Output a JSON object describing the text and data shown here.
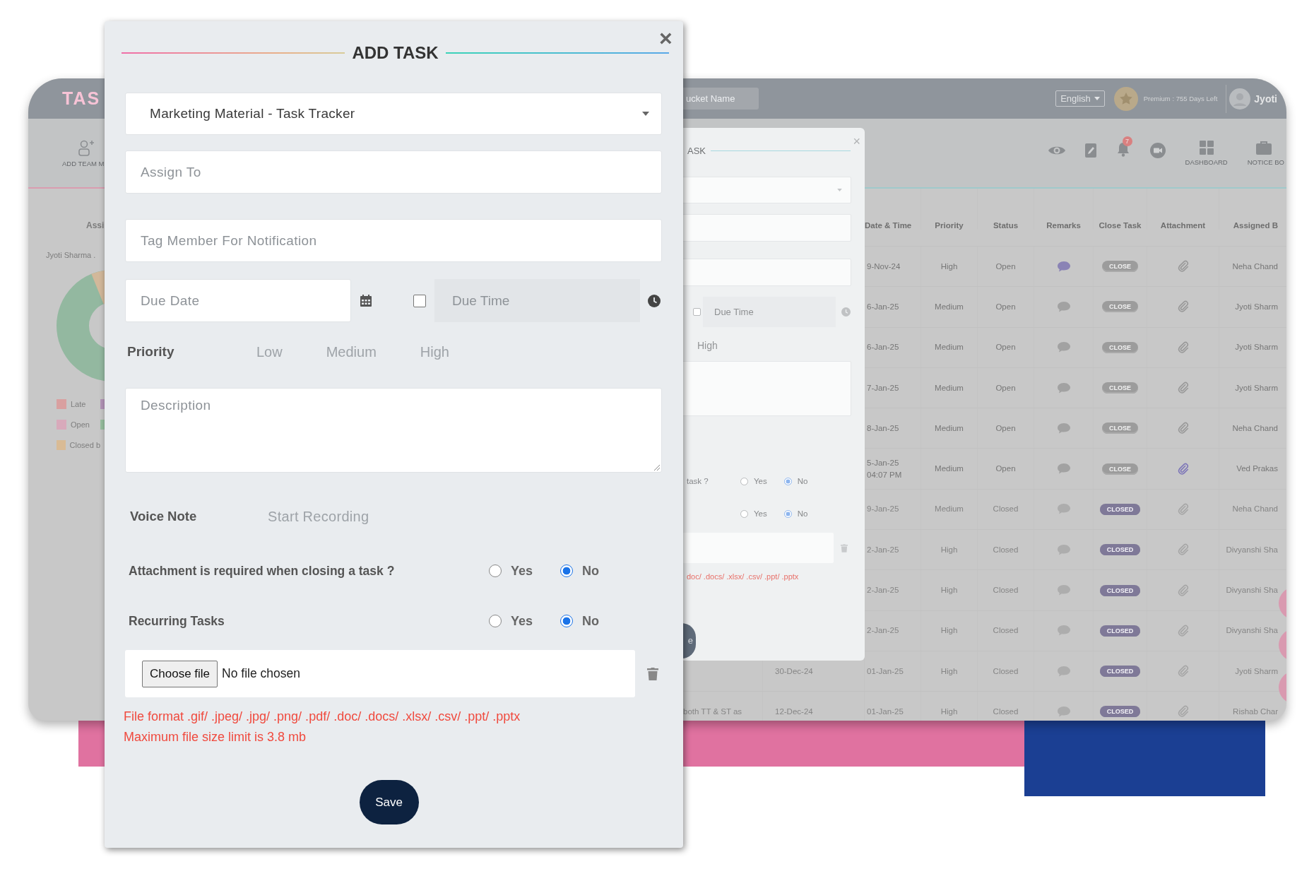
{
  "background_app": {
    "logo": "TAS",
    "bucket_field": {
      "placeholder": "ucket Name"
    },
    "language": "English",
    "premium": "Premium : 755 Days Left",
    "user": "Jyoti",
    "toolbar": {
      "add_team": "ADD TEAM M",
      "notification_count": "7",
      "dashboard": "DASHBOARD",
      "notice_board": "NOTICE BO"
    },
    "left_panel": {
      "heading": "Assi",
      "member": "Jyoti Sharma .",
      "legend": [
        {
          "label": "Late",
          "color": "#d9a0a0"
        },
        {
          "color": "#b495b8"
        },
        {
          "label": "Open",
          "color": "#d8aabb"
        },
        {
          "color": "#98c0a0"
        },
        {
          "label": "Closed b",
          "color": "#d9bb95"
        }
      ]
    },
    "table": {
      "columns": [
        "Date & Time",
        "Priority",
        "Status",
        "Remarks",
        "Close Task",
        "Attachment",
        "Assigned B"
      ],
      "rows": [
        {
          "date": "9-Nov-24",
          "priority": "High",
          "status": "Open",
          "remark_highlight": true,
          "close_label": "CLOSE",
          "closed": false,
          "attachment_highlight": false,
          "assigned_by": "Neha Chand"
        },
        {
          "date": "6-Jan-25",
          "priority": "Medium",
          "status": "Open",
          "remark_highlight": false,
          "close_label": "CLOSE",
          "closed": false,
          "attachment_highlight": false,
          "assigned_by": "Jyoti Sharm"
        },
        {
          "date": "6-Jan-25",
          "priority": "Medium",
          "status": "Open",
          "remark_highlight": false,
          "close_label": "CLOSE",
          "closed": false,
          "attachment_highlight": false,
          "assigned_by": "Jyoti Sharm"
        },
        {
          "date": "7-Jan-25",
          "priority": "Medium",
          "status": "Open",
          "remark_highlight": false,
          "close_label": "CLOSE",
          "closed": false,
          "attachment_highlight": false,
          "assigned_by": "Jyoti Sharm"
        },
        {
          "date": "8-Jan-25",
          "priority": "Medium",
          "status": "Open",
          "remark_highlight": false,
          "close_label": "CLOSE",
          "closed": false,
          "attachment_highlight": false,
          "assigned_by": "Neha Chand"
        },
        {
          "date": "5-Jan-25",
          "time": "04:07 PM",
          "priority": "Medium",
          "status": "Open",
          "remark_highlight": false,
          "close_label": "CLOSE",
          "closed": false,
          "attachment_highlight": true,
          "assigned_by": "Ved Prakas"
        },
        {
          "date": "9-Jan-25",
          "priority": "Medium",
          "status": "Closed",
          "remark_highlight": false,
          "close_label": "CLOSED",
          "closed": true,
          "attachment_highlight": false,
          "assigned_by": "Neha Chand"
        },
        {
          "date": "2-Jan-25",
          "priority": "High",
          "status": "Closed",
          "remark_highlight": false,
          "close_label": "CLOSED",
          "closed": true,
          "attachment_highlight": false,
          "assigned_by": "Divyanshi Sha"
        },
        {
          "date": "2-Jan-25",
          "priority": "High",
          "status": "Closed",
          "remark_highlight": false,
          "close_label": "CLOSED",
          "closed": true,
          "attachment_highlight": false,
          "assigned_by": "Divyanshi Sha"
        },
        {
          "date": "2-Jan-25",
          "priority": "High",
          "status": "Closed",
          "remark_highlight": false,
          "close_label": "CLOSED",
          "closed": true,
          "attachment_highlight": false,
          "assigned_by": "Divyanshi Sha"
        },
        {
          "created": "30-Dec-24",
          "date": "01-Jan-25",
          "priority": "High",
          "status": "Closed",
          "remark_highlight": false,
          "close_label": "CLOSED",
          "closed": true,
          "attachment_highlight": false,
          "assigned_by": "Jyoti Sharm"
        },
        {
          "task": "both TT & ST as",
          "created": "12-Dec-24",
          "date": "01-Jan-25",
          "priority": "High",
          "status": "Closed",
          "remark_highlight": false,
          "close_label": "CLOSED",
          "closed": true,
          "attachment_highlight": false,
          "assigned_by": "Rishab Char"
        }
      ]
    }
  },
  "back_modal": {
    "title": "ASK",
    "close": "×",
    "due_time": {
      "checked": false,
      "placeholder": "Due Time"
    },
    "priority_option": "High",
    "question_fragment": "task ?",
    "questions": [
      {
        "options": [
          {
            "label": "Yes",
            "selected": false
          },
          {
            "label": "No",
            "selected": true
          }
        ]
      },
      {
        "options": [
          {
            "label": "Yes",
            "selected": false
          },
          {
            "label": "No",
            "selected": true
          }
        ]
      }
    ],
    "note": "doc/ .docs/ .xlsx/ .csv/ .ppt/ .pptx",
    "save": "e"
  },
  "modal": {
    "title": "ADD TASK",
    "close": "×",
    "project_select": {
      "value": "Marketing Material - Task Tracker"
    },
    "assign_to": {
      "placeholder": "Assign To"
    },
    "tag_member": {
      "placeholder": "Tag Member For Notification"
    },
    "due_date": {
      "placeholder": "Due Date"
    },
    "due_time": {
      "checked": false,
      "placeholder": "Due Time"
    },
    "priority": {
      "label": "Priority",
      "options": [
        {
          "label": "Low",
          "selected": false
        },
        {
          "label": "Medium",
          "selected": false
        },
        {
          "label": "High",
          "selected": false
        }
      ]
    },
    "description": {
      "placeholder": "Description"
    },
    "voice_note": {
      "label": "Voice Note",
      "action": "Start Recording"
    },
    "questions": [
      {
        "label": "Attachment is required when closing a task ?",
        "options": [
          {
            "label": "Yes",
            "selected": false
          },
          {
            "label": "No",
            "selected": true
          }
        ]
      },
      {
        "label": "Recurring Tasks",
        "options": [
          {
            "label": "Yes",
            "selected": false
          },
          {
            "label": "No",
            "selected": true
          }
        ]
      }
    ],
    "file": {
      "button": "Choose file",
      "status": "No file chosen"
    },
    "notes": [
      "File format .gif/ .jpeg/ .jpg/ .png/ .pdf/ .doc/ .docs/ .xlsx/ .csv/ .ppt/ .pptx",
      "Maximum file size limit is 3.8 mb"
    ],
    "save": "Save"
  }
}
